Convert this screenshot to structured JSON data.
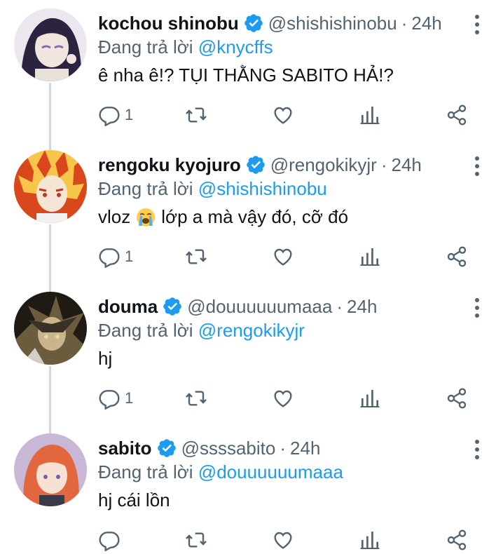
{
  "reply_prefix": "Đang trả lời",
  "colors": {
    "accent": "#1d9bf0",
    "secondary_text": "#536471",
    "primary_text": "#0f1419",
    "thread_line": "#cfd9de"
  },
  "tweets": [
    {
      "name": "kochou shinobu",
      "handle": "@shishishinobu",
      "time": "24h",
      "reply_to": "@knycffs",
      "text": "ê nha ê!? TỤI THẰNG SABITO HẢ!?",
      "text_after_emoji": "",
      "emoji": "",
      "reply_count": "1",
      "avatar_colors": [
        "#2c2340",
        "#f1e6df",
        "#8a6aa8"
      ]
    },
    {
      "name": "rengoku kyojuro",
      "handle": "@rengokikyjr",
      "time": "24h",
      "reply_to": "@shishishinobu",
      "text": "vloz",
      "emoji": "loudly-crying-face",
      "text_after_emoji": "lớp a mà vậy đó, cỡ đó",
      "reply_count": "1",
      "avatar_colors": [
        "#d9481c",
        "#f6c54a",
        "#f5e5d4"
      ]
    },
    {
      "name": "douma",
      "handle": "@douuuuuumaaa",
      "time": "24h",
      "reply_to": "@rengokikyjr",
      "text": "hj",
      "text_after_emoji": "",
      "emoji": "",
      "reply_count": "1",
      "avatar_colors": [
        "#1f1a14",
        "#c9b48c",
        "#6b5c3e"
      ]
    },
    {
      "name": "sabito",
      "handle": "@ssssabito",
      "time": "24h",
      "reply_to": "@douuuuuumaaa",
      "text": "hj cái lồn",
      "text_after_emoji": "",
      "emoji": "",
      "reply_count": "",
      "avatar_colors": [
        "#c9b7d6",
        "#e2673e",
        "#f6e1d3"
      ]
    }
  ],
  "icons": {
    "reply": "reply-icon",
    "retweet": "retweet-icon",
    "like": "like-icon",
    "views": "views-icon",
    "share": "share-icon",
    "more": "more-vertical-icon",
    "verified": "verified-badge-icon"
  }
}
